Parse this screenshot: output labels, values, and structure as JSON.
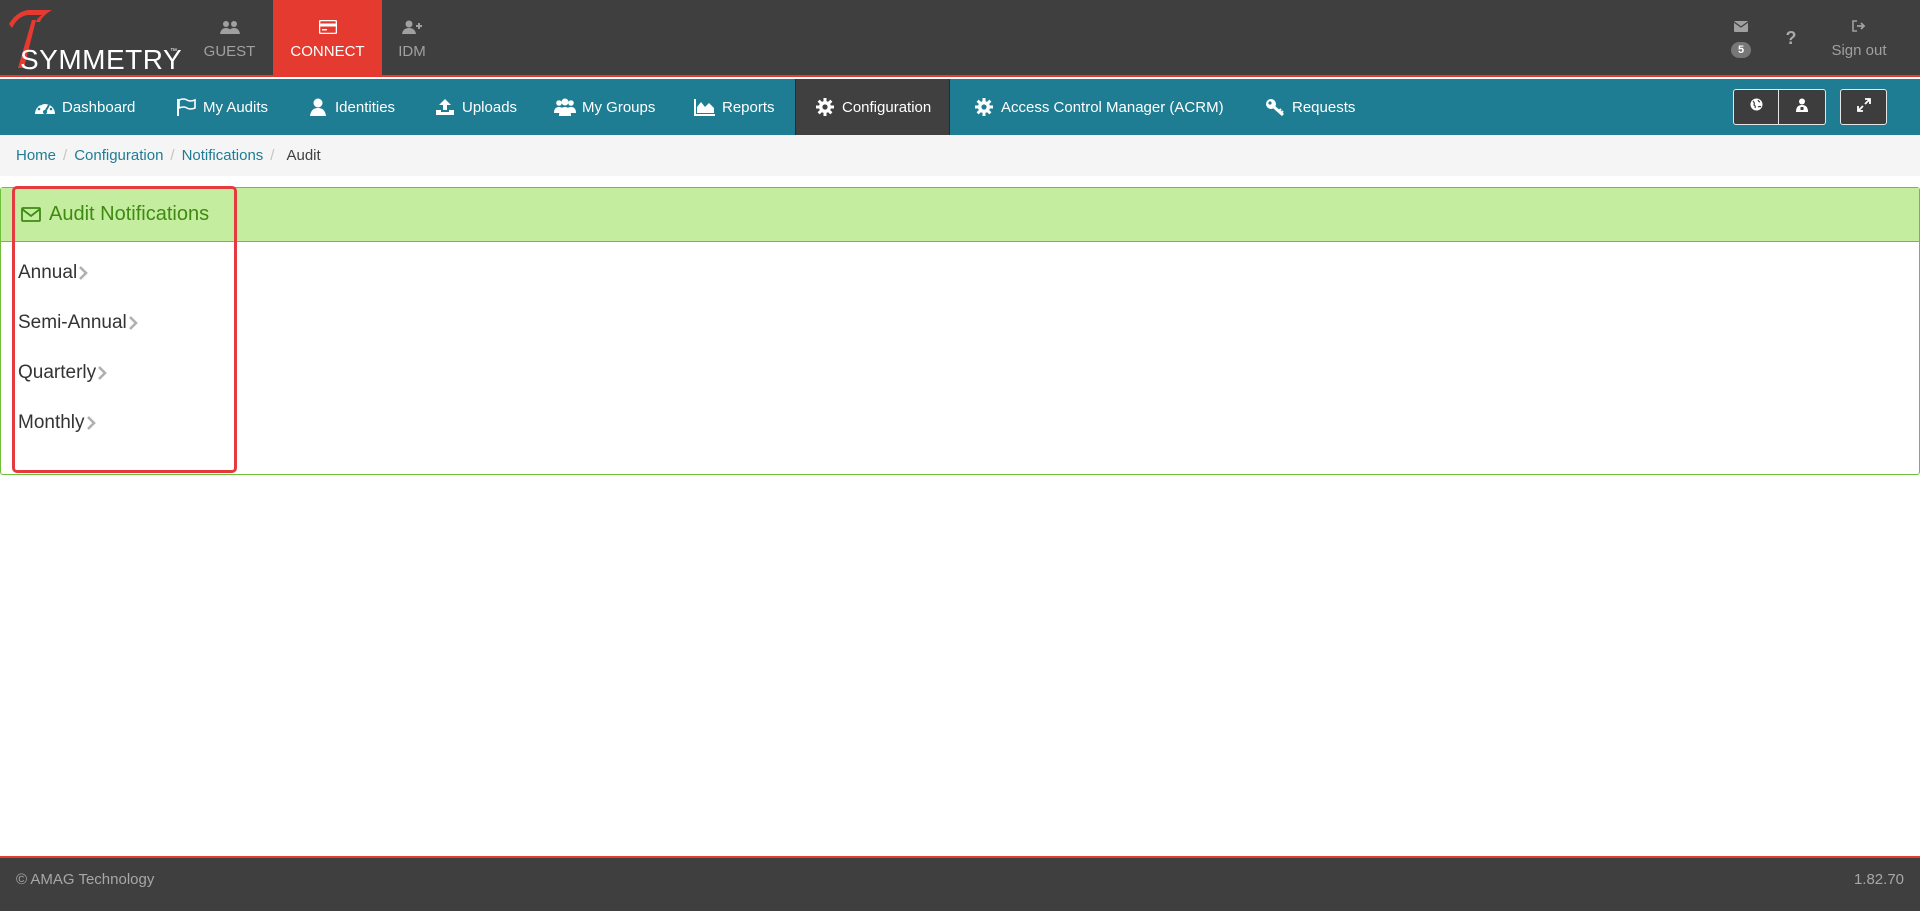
{
  "brand": {
    "name": "SYMMETRY",
    "trademark": "™",
    "accent": "#e53a2f"
  },
  "app_tabs": [
    {
      "label": "GUEST",
      "icon": "users-icon",
      "active": false
    },
    {
      "label": "CONNECT",
      "icon": "card-icon",
      "active": true
    },
    {
      "label": "IDM",
      "icon": "user-plus-icon",
      "active": false
    }
  ],
  "top_right": {
    "mail_badge": "5",
    "help": "?",
    "signout_label": "Sign out"
  },
  "nav": {
    "items": [
      {
        "label": "Dashboard",
        "icon": "dashboard-icon"
      },
      {
        "label": "My Audits",
        "icon": "flag-icon"
      },
      {
        "label": "Identities",
        "icon": "user-icon"
      },
      {
        "label": "Uploads",
        "icon": "upload-icon"
      },
      {
        "label": "My Groups",
        "icon": "users-icon"
      },
      {
        "label": "Reports",
        "icon": "area-chart-icon"
      },
      {
        "label": "Configuration",
        "icon": "gear-icon",
        "active": true
      },
      {
        "label": "Access Control Manager (ACRM)",
        "icon": "gear-icon"
      },
      {
        "label": "Requests",
        "icon": "key-icon"
      }
    ],
    "color": "#1e7d93"
  },
  "breadcrumb": {
    "items": [
      "Home",
      "Configuration",
      "Notifications"
    ],
    "current": "Audit"
  },
  "panel": {
    "title": "Audit Notifications",
    "items": [
      "Annual",
      "Semi-Annual",
      "Quarterly",
      "Monthly"
    ]
  },
  "footer": {
    "copyright": "© AMAG Technology",
    "version": "1.82.70"
  }
}
